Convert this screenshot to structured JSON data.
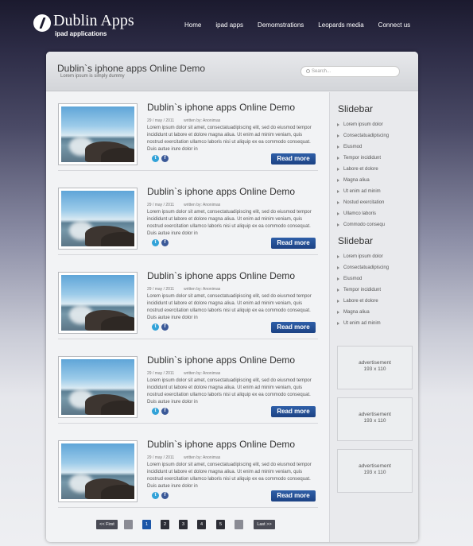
{
  "header": {
    "logo_title": "Dublin Apps",
    "logo_sub": "ipad applications",
    "nav": [
      "Home",
      "ipad apps",
      "Demomstrations",
      "Leopards media",
      "Connect us"
    ]
  },
  "panel": {
    "title": "Dublin`s iphone apps Online Demo",
    "subtitle": "Lorem ipsum is simply dummy",
    "search_placeholder": "Search..."
  },
  "posts": [
    {
      "title": "Dublin`s iphone apps Online Demo",
      "date": "29 / may / 2011",
      "author": "written by:  Anonimas",
      "body": "Lorem ipsum dolor sit amet, consectatuadipiscing elit, sed do eiusmod tempor incididunt ut labore et dolore magna aliua. Ut enim ad minim veniam, quis nostrud exercitation ullamco laboris nisi ut aliquip ex ea commodo consequat. Duis autue irure dolor in",
      "read_more": "Read more"
    },
    {
      "title": "Dublin`s iphone apps Online Demo",
      "date": "29 / may / 2011",
      "author": "written by:  Anonimas",
      "body": "Lorem ipsum dolor sit amet, consectatuadipiscing elit, sed do eiusmod tempor incididunt ut labore et dolore magna aliua. Ut enim ad minim veniam, quis nostrud exercitation ullamco laboris nisi ut aliquip ex ea commodo consequat. Duis autue irure dolor in",
      "read_more": "Read more"
    },
    {
      "title": "Dublin`s iphone apps Online Demo",
      "date": "29 / may / 2011",
      "author": "written by:  Anonimas",
      "body": "Lorem ipsum dolor sit amet, consectatuadipiscing elit, sed do eiusmod tempor incididunt ut labore et dolore magna aliua. Ut enim ad minim veniam, quis nostrud exercitation ullamco laboris nisi ut aliquip ex ea commodo consequat. Duis autue irure dolor in",
      "read_more": "Read more"
    },
    {
      "title": "Dublin`s iphone apps Online Demo",
      "date": "29 / may / 2011",
      "author": "written by:  Anonimas",
      "body": "Lorem ipsum dolor sit amet, consectatuadipiscing elit, sed do eiusmod tempor incididunt ut labore et dolore magna aliua. Ut enim ad minim veniam, quis nostrud exercitation ullamco laboris nisi ut aliquip ex ea commodo consequat. Duis autue irure dolor in",
      "read_more": "Read more"
    },
    {
      "title": "Dublin`s iphone apps Online Demo",
      "date": "29 / may / 2011",
      "author": "written by:  Anonimas",
      "body": "Lorem ipsum dolor sit amet, consectatuadipiscing elit, sed do eiusmod tempor incididunt ut labore et dolore magna aliua. Ut enim ad minim veniam, quis nostrud exercitation ullamco laboris nisi ut aliquip ex ea commodo consequat. Duis autue irure dolor in",
      "read_more": "Read more"
    }
  ],
  "sidebar": [
    {
      "title": "Slidebar",
      "items": [
        "Lorem ipsum dolor",
        "Consectatuadipiscing",
        "Eiusmod",
        "Tempor incididunt",
        "Labore et dolore",
        "Magna aliua",
        "Ut enim ad minim",
        "Nostud exercitation",
        "Ullamco laboris",
        "Commodo consequ"
      ]
    },
    {
      "title": "Slidebar",
      "items": [
        "Lorem ipsum dolor",
        "Consectatuadipiscing",
        "Eiusmod",
        "Tempor incididunt",
        "Labore et dolore",
        "Magna aliua",
        "Ut enim ad minim"
      ]
    }
  ],
  "ads": [
    {
      "label": "advertisement",
      "size": "193 x 110"
    },
    {
      "label": "advertisement",
      "size": "193 x 110"
    },
    {
      "label": "advertisement",
      "size": "193 x 110"
    }
  ],
  "pagination": {
    "first": "<< First",
    "last": "Last >>",
    "pages": [
      "",
      "1",
      "2",
      "3",
      "4",
      "5",
      ""
    ],
    "active": "1"
  },
  "icons": {
    "twitter": "twitter-icon",
    "facebook": "facebook-icon",
    "search": "search-icon"
  },
  "colors": {
    "button": "#1c4284",
    "active_page": "#1c56a8"
  }
}
